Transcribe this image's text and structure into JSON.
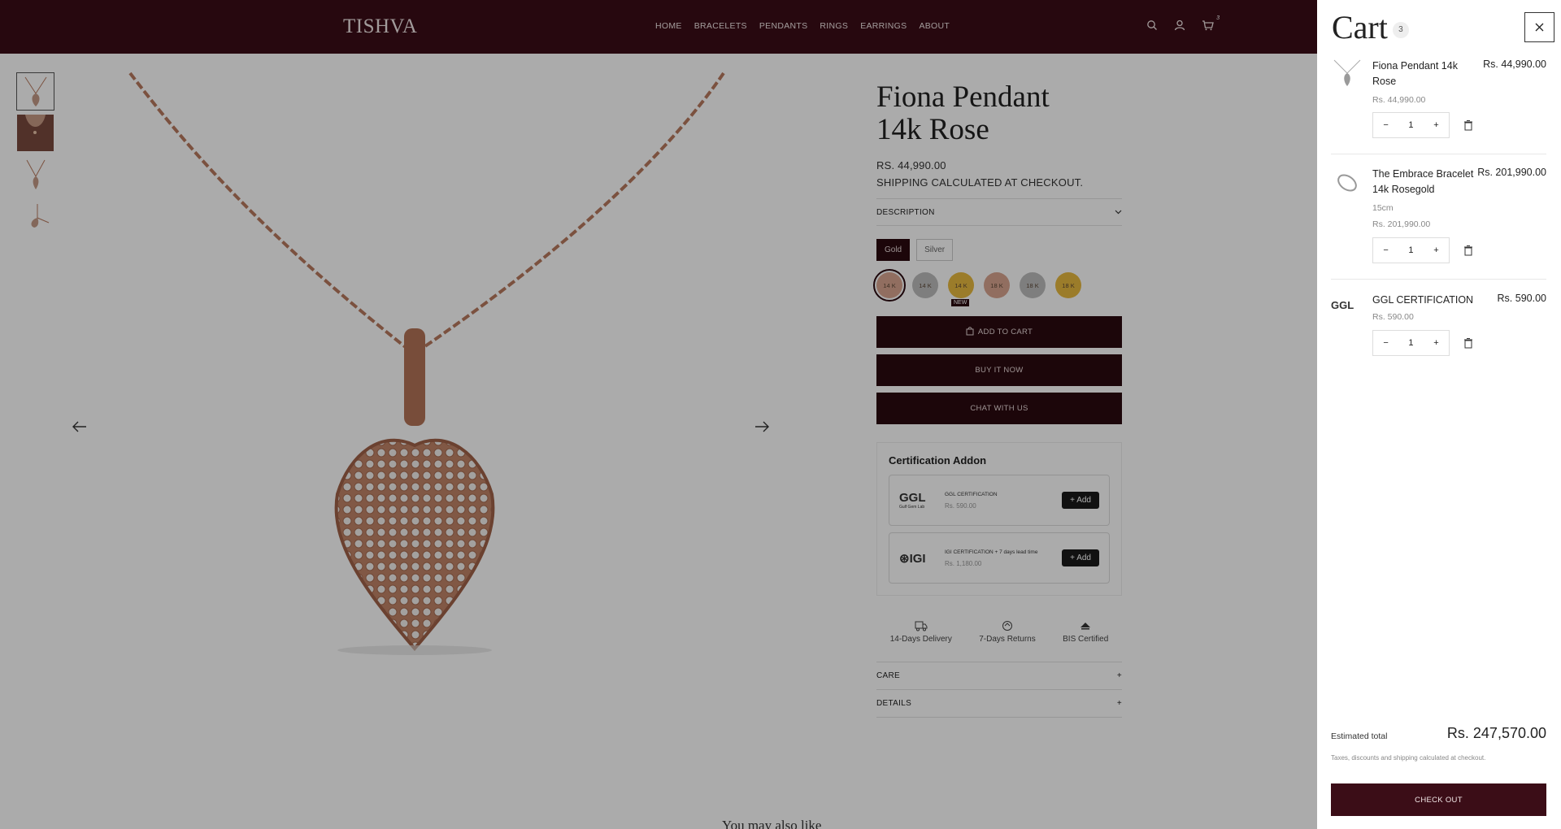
{
  "header": {
    "logo": "TISHVA",
    "nav": [
      "HOME",
      "BRACELETS",
      "PENDANTS",
      "RINGS",
      "EARRINGS",
      "ABOUT"
    ],
    "cart_count": "3"
  },
  "product": {
    "title_line1": "Fiona Pendant",
    "title_line2": "14k Rose",
    "price": "RS. 44,990.00",
    "shipping": "SHIPPING CALCULATED AT CHECKOUT.",
    "description_label": "DESCRIPTION",
    "metals": [
      "Gold",
      "Silver"
    ],
    "karats": [
      "14 K",
      "14 K",
      "14 K",
      "18 K",
      "18 K",
      "18 K"
    ],
    "new_badge": "NEW",
    "add_to_cart": "ADD TO CART",
    "buy_now": "BUY IT NOW",
    "chat": "CHAT WITH US",
    "cert_title": "Certification Addon",
    "certs": [
      {
        "logo": "GGL",
        "logo_sub": "Gulf Gem Lab",
        "name": "GGL CERTIFICATION",
        "price": "Rs. 590.00",
        "add": "Add"
      },
      {
        "logo": "IGI",
        "name": "IGI CERTIFICATION + 7 days lead time",
        "price": "Rs. 1,180.00",
        "add": "Add"
      }
    ],
    "features": [
      "14-Days Delivery",
      "7-Days Returns",
      "BIS Certified"
    ],
    "accordions": [
      "CARE",
      "DETAILS"
    ],
    "also_like": "You may also like"
  },
  "cart": {
    "title": "Cart",
    "count": "3",
    "items": [
      {
        "name": "Fiona Pendant 14k Rose",
        "price": "Rs. 44,990.00",
        "sub": "Rs. 44,990.00",
        "qty": "1"
      },
      {
        "name": "The Embrace Bracelet 14k Rosegold",
        "price": "Rs. 201,990.00",
        "variant": "15cm",
        "sub": "Rs. 201,990.00",
        "qty": "1"
      },
      {
        "name": "GGL CERTIFICATION",
        "price": "Rs. 590.00",
        "sub": "Rs. 590.00",
        "qty": "1"
      }
    ],
    "estimated_label": "Estimated total",
    "estimated_value": "Rs. 247,570.00",
    "tax_note": "Taxes, discounts and shipping calculated at checkout.",
    "checkout": "CHECK OUT"
  },
  "colors": {
    "brand": "#3b0d17",
    "rose_gold": "#b87a5e"
  }
}
